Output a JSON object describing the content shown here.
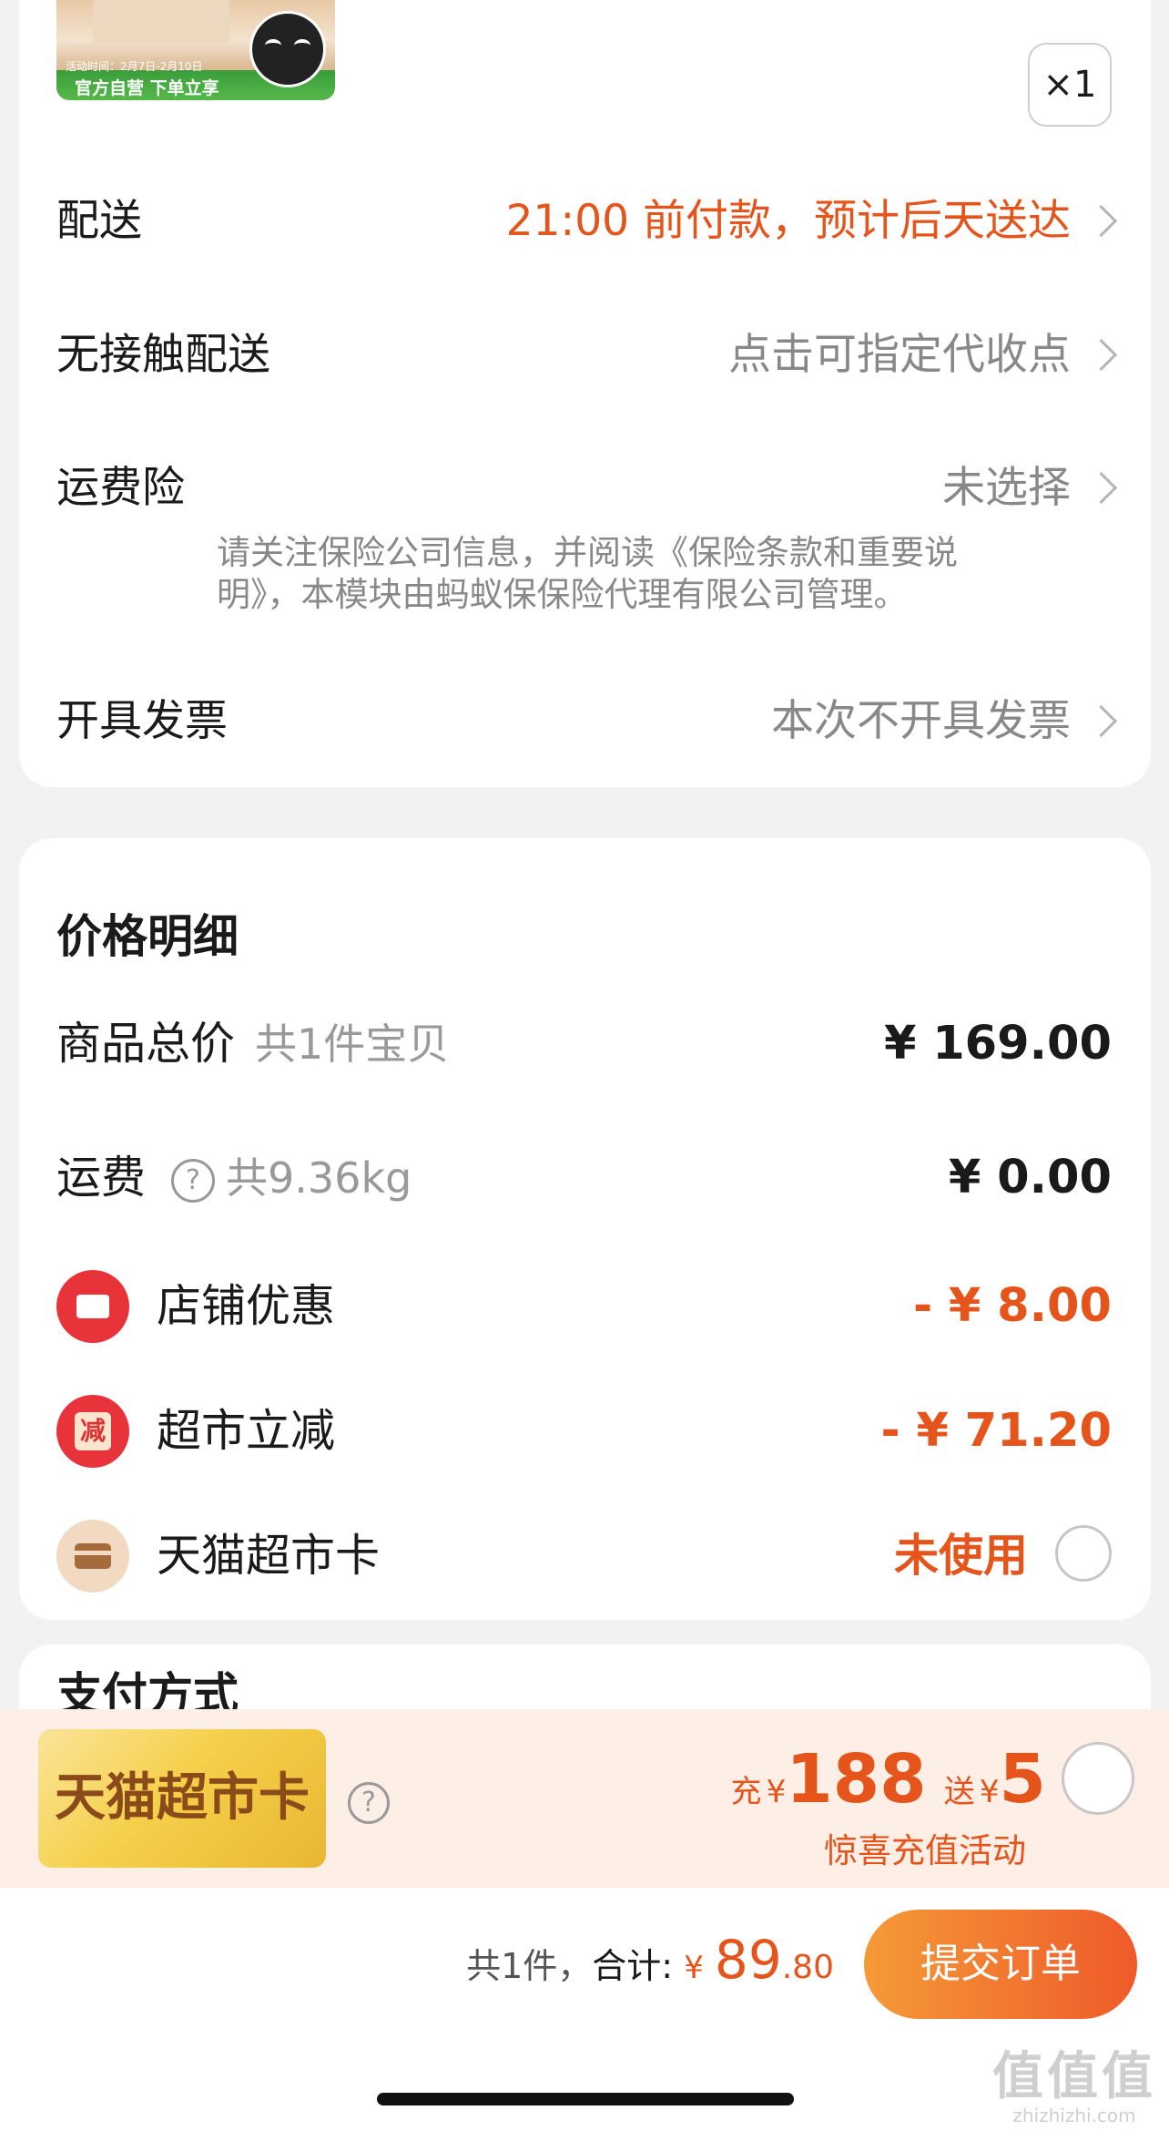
{
  "product": {
    "thumb_date": "活动时间：2月7日-2月10日",
    "thumb_banner": "官方自营 下单立享",
    "quantity": "×1"
  },
  "order_rows": [
    {
      "label": "配送",
      "value": "21:00 前付款，预计后天送达"
    },
    {
      "label": "无接触配送",
      "value": "点击可指定代收点"
    },
    {
      "label": "运费险",
      "value": "未选择",
      "notice": "请关注保险公司信息，并阅读《保险条款和重要说明》，本模块由蚂蚁保保险代理有限公司管理。"
    },
    {
      "label": "开具发票",
      "value": "本次不开具发票"
    }
  ],
  "price_detail": {
    "title": "价格明细",
    "goods_total": {
      "label": "商品总价",
      "sub": "共1件宝贝",
      "amount": "¥ 169.00"
    },
    "shipping": {
      "label": "运费",
      "sub": "共9.36kg",
      "amount": "¥ 0.00",
      "icon": "?"
    },
    "shop_discount": {
      "label": "店铺优惠",
      "amount": "- ¥ 8.00"
    },
    "market_discount": {
      "label": "超市立减",
      "amount": "- ¥ 71.20",
      "icon_text": "减"
    },
    "market_card": {
      "label": "天猫超市卡",
      "status": "未使用"
    }
  },
  "payment": {
    "title": "支付方式"
  },
  "promo": {
    "badge": "天猫超市卡",
    "help": "?",
    "charge_word": "充",
    "currency": "¥",
    "charge_amount": "188",
    "gift_word": "送",
    "gift_amount": "5",
    "subtitle": "惊喜充值活动"
  },
  "bottom": {
    "count": "共1件，",
    "total_label": "合计:",
    "currency": "¥",
    "total_int": "89",
    "total_dec": ".80",
    "submit": "提交订单"
  },
  "watermark": {
    "main": "值值值",
    "domain": "zhizhizhi.com"
  },
  "colors": {
    "accent": "#e5541a",
    "submit_start": "#f59a37",
    "submit_end": "#ef5a2a",
    "badge_gold": "#f5d04a"
  }
}
